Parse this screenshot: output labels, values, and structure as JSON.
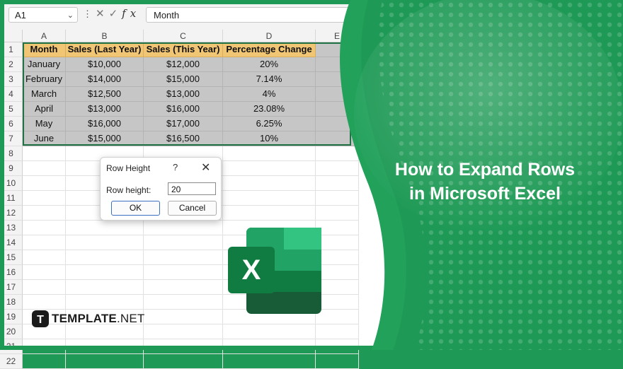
{
  "formula_bar": {
    "name_box": "A1",
    "cancel_glyph": "✕",
    "enter_glyph": "✓",
    "fx_label": "fx",
    "content": "Month"
  },
  "columns": [
    "A",
    "B",
    "C",
    "D",
    "E"
  ],
  "rows": [
    "1",
    "2",
    "3",
    "4",
    "5",
    "6",
    "7",
    "8",
    "9",
    "10",
    "11",
    "12",
    "13",
    "14",
    "15",
    "16",
    "17",
    "18",
    "19",
    "20",
    "21",
    "22"
  ],
  "table": {
    "headers": [
      "Month",
      "Sales (Last Year)",
      "Sales (This Year)",
      "Percentage Change"
    ],
    "data": [
      [
        "January",
        "$10,000",
        "$12,000",
        "20%"
      ],
      [
        "February",
        "$14,000",
        "$15,000",
        "7.14%"
      ],
      [
        "March",
        "$12,500",
        "$13,000",
        "4%"
      ],
      [
        "April",
        "$13,000",
        "$16,000",
        "23.08%"
      ],
      [
        "May",
        "$16,000",
        "$17,000",
        "6.25%"
      ],
      [
        "June",
        "$15,000",
        "$16,500",
        "10%"
      ]
    ]
  },
  "dialog": {
    "title": "Row Height",
    "help": "?",
    "close": "✕",
    "label": "Row height:",
    "value": "20",
    "ok": "OK",
    "cancel": "Cancel"
  },
  "banner": {
    "line1": "How to Expand Rows",
    "line2": "in Microsoft Excel",
    "excel_letter": "X"
  },
  "brand": {
    "name": "TEMPLATE",
    "suffix": ".NET",
    "icon_letter": "T"
  },
  "colors": {
    "green_primary": "#1f9a56",
    "green_light": "#3cba74",
    "header_fill": "#f0c574",
    "selection_fill": "#c6c6c6",
    "excel_dark": "#185c37",
    "excel_mid": "#21a366",
    "excel_light": "#33c481"
  }
}
